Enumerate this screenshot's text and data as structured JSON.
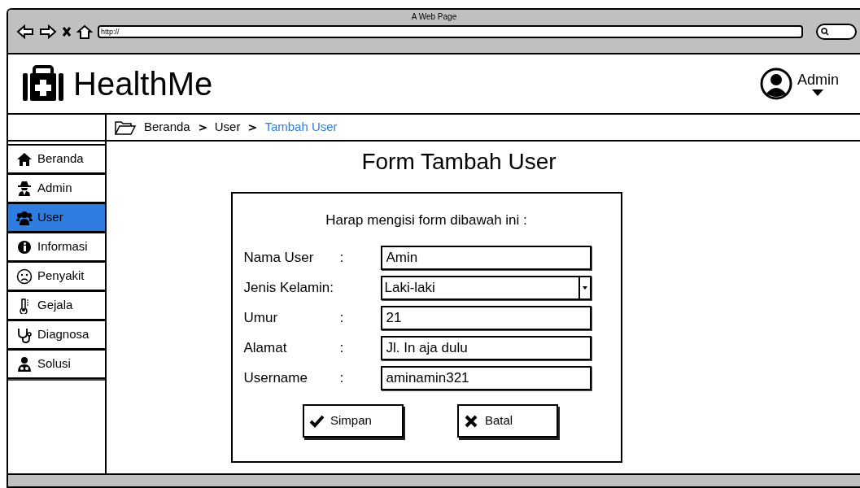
{
  "window": {
    "title": "A Web Page",
    "url": "http://"
  },
  "header": {
    "app_name": "HealthMe",
    "user": "Admin"
  },
  "breadcrumb": [
    {
      "label": "Beranda",
      "current": false
    },
    {
      "label": "User",
      "current": false
    },
    {
      "label": "Tambah User",
      "current": true
    }
  ],
  "sidebar": {
    "items": [
      {
        "label": "Beranda",
        "selected": false
      },
      {
        "label": "Admin",
        "selected": false
      },
      {
        "label": "User",
        "selected": true
      },
      {
        "label": "Informasi",
        "selected": false
      },
      {
        "label": "Penyakit",
        "selected": false
      },
      {
        "label": "Gejala",
        "selected": false
      },
      {
        "label": "Diagnosa",
        "selected": false
      },
      {
        "label": "Solusi",
        "selected": false
      }
    ]
  },
  "form": {
    "title": "Form Tambah User",
    "instruction": "Harap mengisi form dibawah ini :",
    "fields": [
      {
        "label": "Nama User",
        "separator": ":",
        "kind": "text",
        "value": "Amin"
      },
      {
        "label": "Jenis Kelamin:",
        "kind": "select",
        "value": "Laki-laki"
      },
      {
        "label": "Umur",
        "separator": ":",
        "kind": "text",
        "value": "21"
      },
      {
        "label": "Alamat",
        "separator": ":",
        "kind": "text",
        "value": "Jl. In aja dulu"
      },
      {
        "label": "Username",
        "separator": ":",
        "kind": "text",
        "value": "aminamin321"
      }
    ],
    "buttons": [
      {
        "label": "Simpan"
      },
      {
        "label": "Batal"
      }
    ]
  }
}
